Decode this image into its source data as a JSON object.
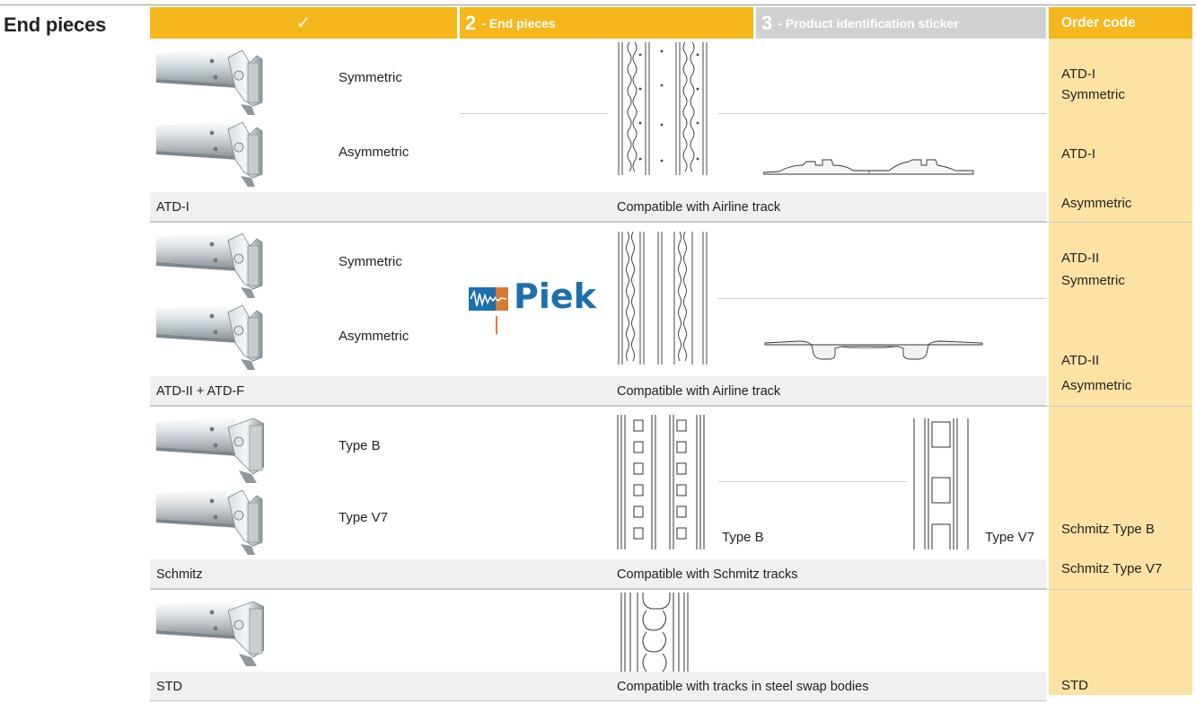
{
  "section": {
    "title": "End pieces"
  },
  "header": {
    "step1": {
      "check": "✓"
    },
    "step2": {
      "num": "2",
      "label": " - End pieces"
    },
    "step3": {
      "num": "3",
      "label": " - Product identification sticker"
    },
    "order_code": "Order code"
  },
  "brand": {
    "logo_text": "Piek"
  },
  "groups": [
    {
      "name": "ATD-I",
      "compat": "Compatible with Airline track",
      "variants": [
        "Symmetric",
        "Asymmetric"
      ],
      "codes": [
        "ATD-I",
        "Symmetric",
        "ATD-I",
        "Asymmetric"
      ]
    },
    {
      "name": "ATD-II + ATD-F",
      "compat": "Compatible with Airline track",
      "variants": [
        "Symmetric",
        "Asymmetric"
      ],
      "codes": [
        "ATD-II",
        "Symmetric",
        "ATD-II",
        "Asymmetric"
      ]
    },
    {
      "name": "Schmitz",
      "compat": "Compatible with Schmitz tracks",
      "variants": [
        "Type B",
        "Type V7"
      ],
      "track_labels": [
        "Type B",
        "Type V7"
      ],
      "codes": [
        "Schmitz Type B",
        "Schmitz Type V7"
      ]
    },
    {
      "name": "STD",
      "compat": "Compatible with tracks in steel swap bodies",
      "variants": [],
      "codes": [
        "STD"
      ]
    }
  ],
  "colors": {
    "accent": "#f5b71c",
    "accent_light": "#fde3a3",
    "header_grey": "#d1d1d1",
    "band_grey": "#f0f0f1",
    "logo_blue": "#1d6fae"
  },
  "icons": [
    "end-piece-photo",
    "airline-track-drawing",
    "schmitz-track-drawing",
    "steel-track-drawing",
    "track-profile-drawing",
    "piek-logo"
  ]
}
